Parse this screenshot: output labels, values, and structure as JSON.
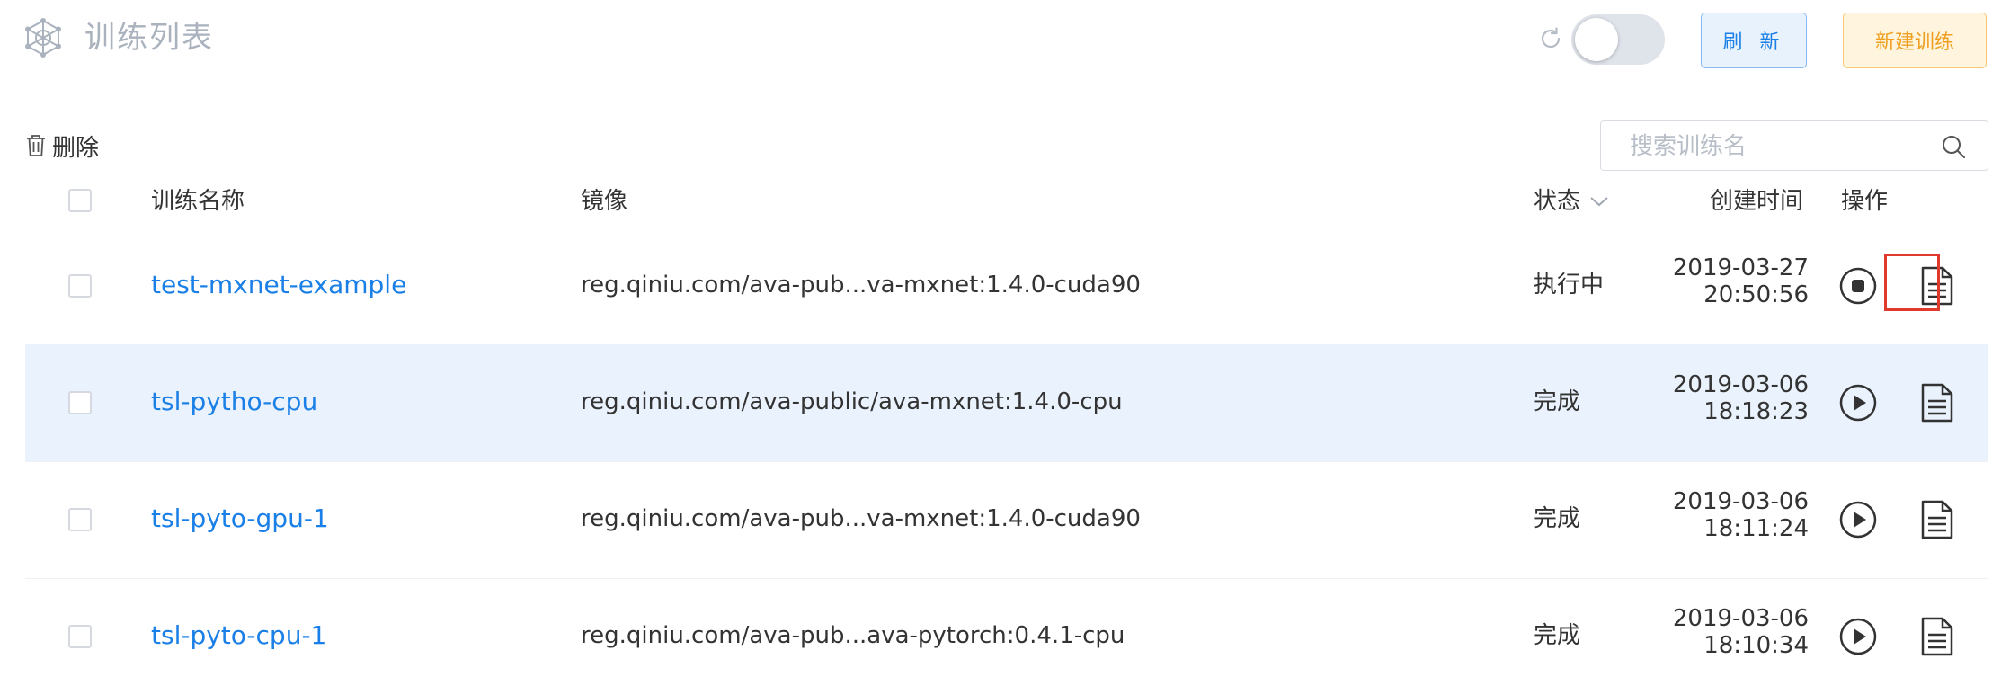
{
  "header": {
    "title": "训练列表",
    "refresh_label": "刷 新",
    "new_label": "新建训练",
    "auto_refresh_on": false
  },
  "toolbar": {
    "delete_label": "删除",
    "search_placeholder": "搜索训练名"
  },
  "table": {
    "columns": {
      "name": "训练名称",
      "image": "镜像",
      "status": "状态",
      "created": "创建时间",
      "actions": "操作"
    },
    "rows": [
      {
        "name": "test-mxnet-example",
        "image": "reg.qiniu.com/ava-pub...va-mxnet:1.4.0-cuda90",
        "status": "执行中",
        "date": "2019-03-27",
        "time": "20:50:56",
        "action_icon": "stop-icon",
        "log_icon": "document-icon"
      },
      {
        "name": "tsl-pytho-cpu",
        "image": "reg.qiniu.com/ava-public/ava-mxnet:1.4.0-cpu",
        "status": "完成",
        "date": "2019-03-06",
        "time": "18:18:23",
        "action_icon": "play-icon",
        "log_icon": "document-icon"
      },
      {
        "name": "tsl-pyto-gpu-1",
        "image": "reg.qiniu.com/ava-pub...va-mxnet:1.4.0-cuda90",
        "status": "完成",
        "date": "2019-03-06",
        "time": "18:11:24",
        "action_icon": "play-icon",
        "log_icon": "document-icon"
      },
      {
        "name": "tsl-pyto-cpu-1",
        "image": "reg.qiniu.com/ava-pub...ava-pytorch:0.4.1-cpu",
        "status": "完成",
        "date": "2019-03-06",
        "time": "18:10:34",
        "action_icon": "play-icon",
        "log_icon": "document-icon"
      }
    ]
  },
  "colors": {
    "accent": "#1a7fe6",
    "warning": "#f0a020",
    "row_highlight": "#eaf3fd",
    "annotation_box": "#e03a2e"
  }
}
